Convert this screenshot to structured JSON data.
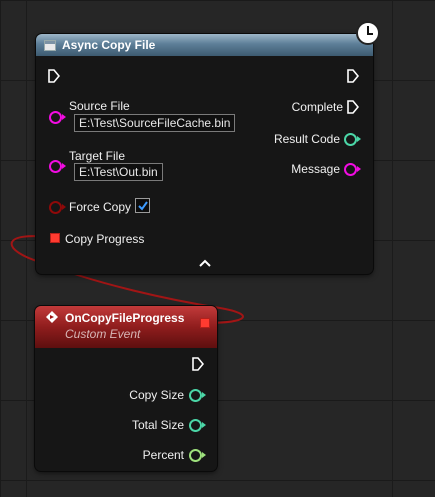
{
  "async_node": {
    "title": "Async Copy File",
    "inputs": {
      "source_file": {
        "label": "Source File",
        "value": "E:\\Test\\SourceFileCache.bin"
      },
      "target_file": {
        "label": "Target File",
        "value": "E:\\Test\\Out.bin"
      },
      "force_copy": {
        "label": "Force Copy",
        "checked": true
      },
      "copy_progress": {
        "label": "Copy Progress"
      }
    },
    "outputs": {
      "complete": "Complete",
      "result_code": "Result Code",
      "message": "Message"
    }
  },
  "event_node": {
    "title": "OnCopyFileProgress",
    "subtitle": "Custom Event",
    "outputs": {
      "copy_size": "Copy Size",
      "total_size": "Total Size",
      "percent": "Percent"
    }
  },
  "colors": {
    "string_pin": "#f20ce2",
    "int_pin": "#4bd6a7",
    "float_pin": "#9ee17d",
    "bool_pin": "#8f0909",
    "delegate_pin": "#ff3b30",
    "wire": "#a11515"
  },
  "icons": [
    "function-icon",
    "latent-clock-icon",
    "event-icon",
    "exec-pin-icon",
    "collapse-arrow-icon",
    "checkmark-icon"
  ]
}
